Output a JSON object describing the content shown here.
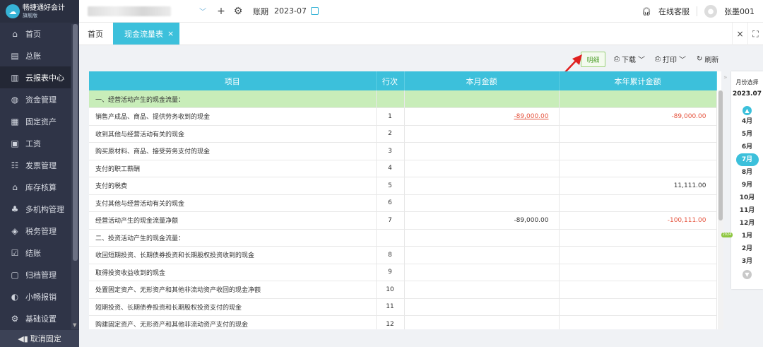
{
  "app": {
    "name": "畅捷通好会计",
    "edition": "旗舰版"
  },
  "sidebar": {
    "items": [
      {
        "label": "首页",
        "icon": "home-icon"
      },
      {
        "label": "总账",
        "icon": "ledger-icon"
      },
      {
        "label": "云报表中心",
        "icon": "chart-icon"
      },
      {
        "label": "资金管理",
        "icon": "money-icon"
      },
      {
        "label": "固定资产",
        "icon": "asset-icon"
      },
      {
        "label": "工资",
        "icon": "salary-icon"
      },
      {
        "label": "发票管理",
        "icon": "invoice-icon"
      },
      {
        "label": "库存核算",
        "icon": "warehouse-icon"
      },
      {
        "label": "多机构管理",
        "icon": "org-icon"
      },
      {
        "label": "税务管理",
        "icon": "tax-icon"
      },
      {
        "label": "结账",
        "icon": "checkout-icon"
      },
      {
        "label": "归档管理",
        "icon": "archive-icon"
      },
      {
        "label": "小畅报销",
        "icon": "reimburse-icon"
      },
      {
        "label": "基础设置",
        "icon": "settings-icon"
      }
    ],
    "unpin_label": "取消固定"
  },
  "topbar": {
    "period_label": "账期",
    "period_value": "2023-07",
    "service_label": "在线客服",
    "user_name": "张墨001"
  },
  "tabs": [
    {
      "label": "首页"
    },
    {
      "label": "现金流量表"
    }
  ],
  "toolbar": {
    "detail_label": "明细",
    "download_label": "下载",
    "print_label": "打印",
    "refresh_label": "刷新"
  },
  "table": {
    "columns": [
      "项目",
      "行次",
      "本月金额",
      "本年累计金额"
    ],
    "rows": [
      {
        "item": "一、经营活动产生的现金流量：",
        "line": "",
        "month": "",
        "year": "",
        "section": true
      },
      {
        "item": "销售产成品、商品、提供劳务收到的现金",
        "line": "1",
        "month": "-89,000.00",
        "year": "-89,000.00"
      },
      {
        "item": "收到其他与经营活动有关的现金",
        "line": "2",
        "month": "",
        "year": ""
      },
      {
        "item": "购买原材料、商品、接受劳务支付的现金",
        "line": "3",
        "month": "",
        "year": ""
      },
      {
        "item": "支付的职工薪酬",
        "line": "4",
        "month": "",
        "year": ""
      },
      {
        "item": "支付的税费",
        "line": "5",
        "month": "",
        "year": "11,111.00"
      },
      {
        "item": "支付其他与经营活动有关的现金",
        "line": "6",
        "month": "",
        "year": ""
      },
      {
        "item": "经营活动产生的现金流量净额",
        "line": "7",
        "month": "-89,000.00",
        "year": "-100,111.00"
      },
      {
        "item": "二、投资活动产生的现金流量：",
        "line": "",
        "month": "",
        "year": ""
      },
      {
        "item": "收回短期投资、长期债券投资和长期股权投资收到的现金",
        "line": "8",
        "month": "",
        "year": ""
      },
      {
        "item": "取得投资收益收到的现金",
        "line": "9",
        "month": "",
        "year": ""
      },
      {
        "item": "处置固定资产、无形资产和其他非流动资产收回的现金净额",
        "line": "10",
        "month": "",
        "year": ""
      },
      {
        "item": "短期投资、长期债券投资和长期股权投资支付的现金",
        "line": "11",
        "month": "",
        "year": ""
      },
      {
        "item": "购建固定资产、无形资产和其他非流动资产支付的现金",
        "line": "12",
        "month": "",
        "year": ""
      }
    ]
  },
  "month_panel": {
    "title": "月份选择",
    "selected": "2023.07",
    "year_tag": "2024",
    "months": [
      "4月",
      "5月",
      "6月",
      "7月",
      "8月",
      "9月",
      "10月",
      "11月",
      "12月",
      "1月",
      "2月",
      "3月"
    ],
    "active_month": "7月"
  },
  "colors": {
    "accent": "#3cc0db",
    "section_bg": "#c8edb9",
    "negative": "#e5533d",
    "sidebar_bg": "#2f3447"
  }
}
